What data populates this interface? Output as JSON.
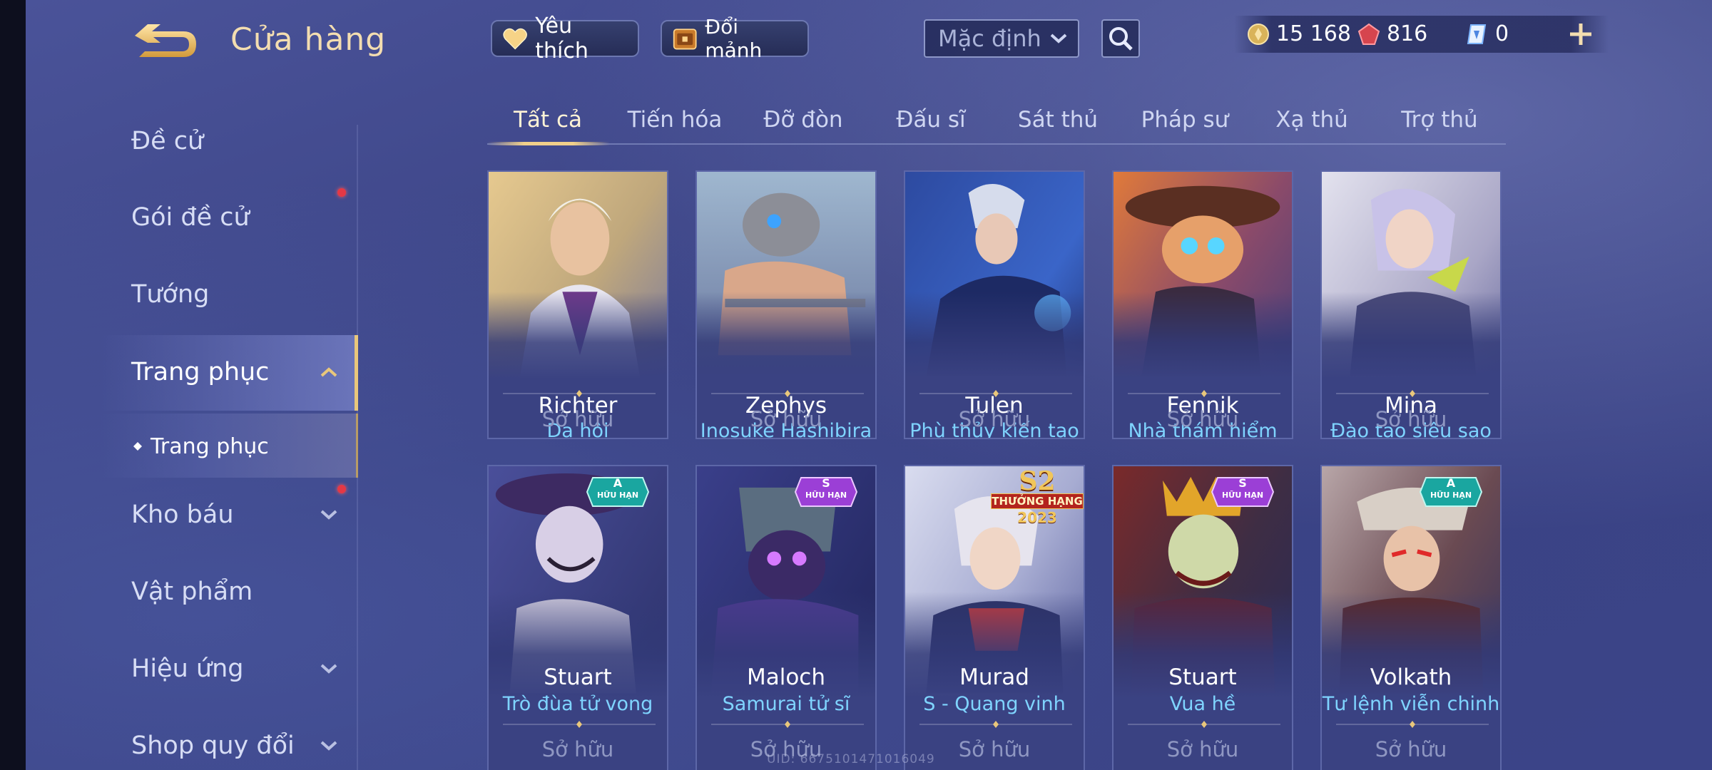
{
  "header": {
    "title": "Cửa hàng",
    "favorite_label": "Yêu thích",
    "swap_label": "Đổi mảnh",
    "sort_value": "Mặc định",
    "currencies": [
      {
        "name": "gold-coin",
        "value": "15 168"
      },
      {
        "name": "red-gem",
        "value": "816"
      },
      {
        "name": "blue-voucher",
        "value": "0"
      }
    ]
  },
  "sidebar": {
    "items": [
      {
        "label": "Đề cử"
      },
      {
        "label": "Gói đề cử"
      },
      {
        "label": "Tướng"
      },
      {
        "label": "Trang phục"
      },
      {
        "label": "Trang phục"
      },
      {
        "label": "Kho báu"
      },
      {
        "label": "Vật phẩm"
      },
      {
        "label": "Hiệu ứng"
      },
      {
        "label": "Shop quy đổi"
      }
    ]
  },
  "tabs": [
    "Tất cả",
    "Tiến hóa",
    "Đỡ đòn",
    "Đấu sĩ",
    "Sát thủ",
    "Pháp sư",
    "Xạ thủ",
    "Trợ thủ"
  ],
  "cards": [
    {
      "hero": "Richter",
      "skin": "Dạ hội",
      "status": "Sở hữu"
    },
    {
      "hero": "Zephys",
      "skin": "Inosuke Hashibira",
      "status": "Sở hữu"
    },
    {
      "hero": "Tulen",
      "skin": "Phù thủy kiến tạo",
      "status": "Sở hữu"
    },
    {
      "hero": "Fennik",
      "skin": "Nhà thám hiểm",
      "status": "Sở hữu"
    },
    {
      "hero": "Mina",
      "skin": "Đào tạo siêu sao",
      "status": "Sở hữu"
    },
    {
      "hero": "Stuart",
      "skin": "Trò đùa tử vong",
      "status": "Sở hữu",
      "badge": {
        "tier": "A",
        "label": "HỮU HẠN",
        "color": "#1aa6a0"
      }
    },
    {
      "hero": "Maloch",
      "skin": "Samurai tử sĩ",
      "status": "Sở hữu",
      "badge": {
        "tier": "S",
        "label": "HỮU HẠN",
        "color": "#9b3fd6"
      }
    },
    {
      "hero": "Murad",
      "skin": "S - Quang vinh",
      "status": "Sở hữu",
      "season_badge": {
        "top": "S2",
        "mid": "THƯỞNG HẠNG",
        "year": "2023"
      }
    },
    {
      "hero": "Stuart",
      "skin": "Vua hề",
      "status": "Sở hữu",
      "badge": {
        "tier": "S",
        "label": "HỮU HẠN",
        "color": "#9b3fd6"
      }
    },
    {
      "hero": "Volkath",
      "skin": "Tư lệnh viễn chinh",
      "status": "Sở hữu",
      "badge": {
        "tier": "A",
        "label": "HỮU HẠN",
        "color": "#1aa6a0"
      }
    }
  ],
  "uid": "UID: 6675101471016049",
  "colors": {
    "accent_gold": "#e9c77b",
    "skin_name": "#7fd4ff",
    "notify_dot": "#e53845"
  }
}
